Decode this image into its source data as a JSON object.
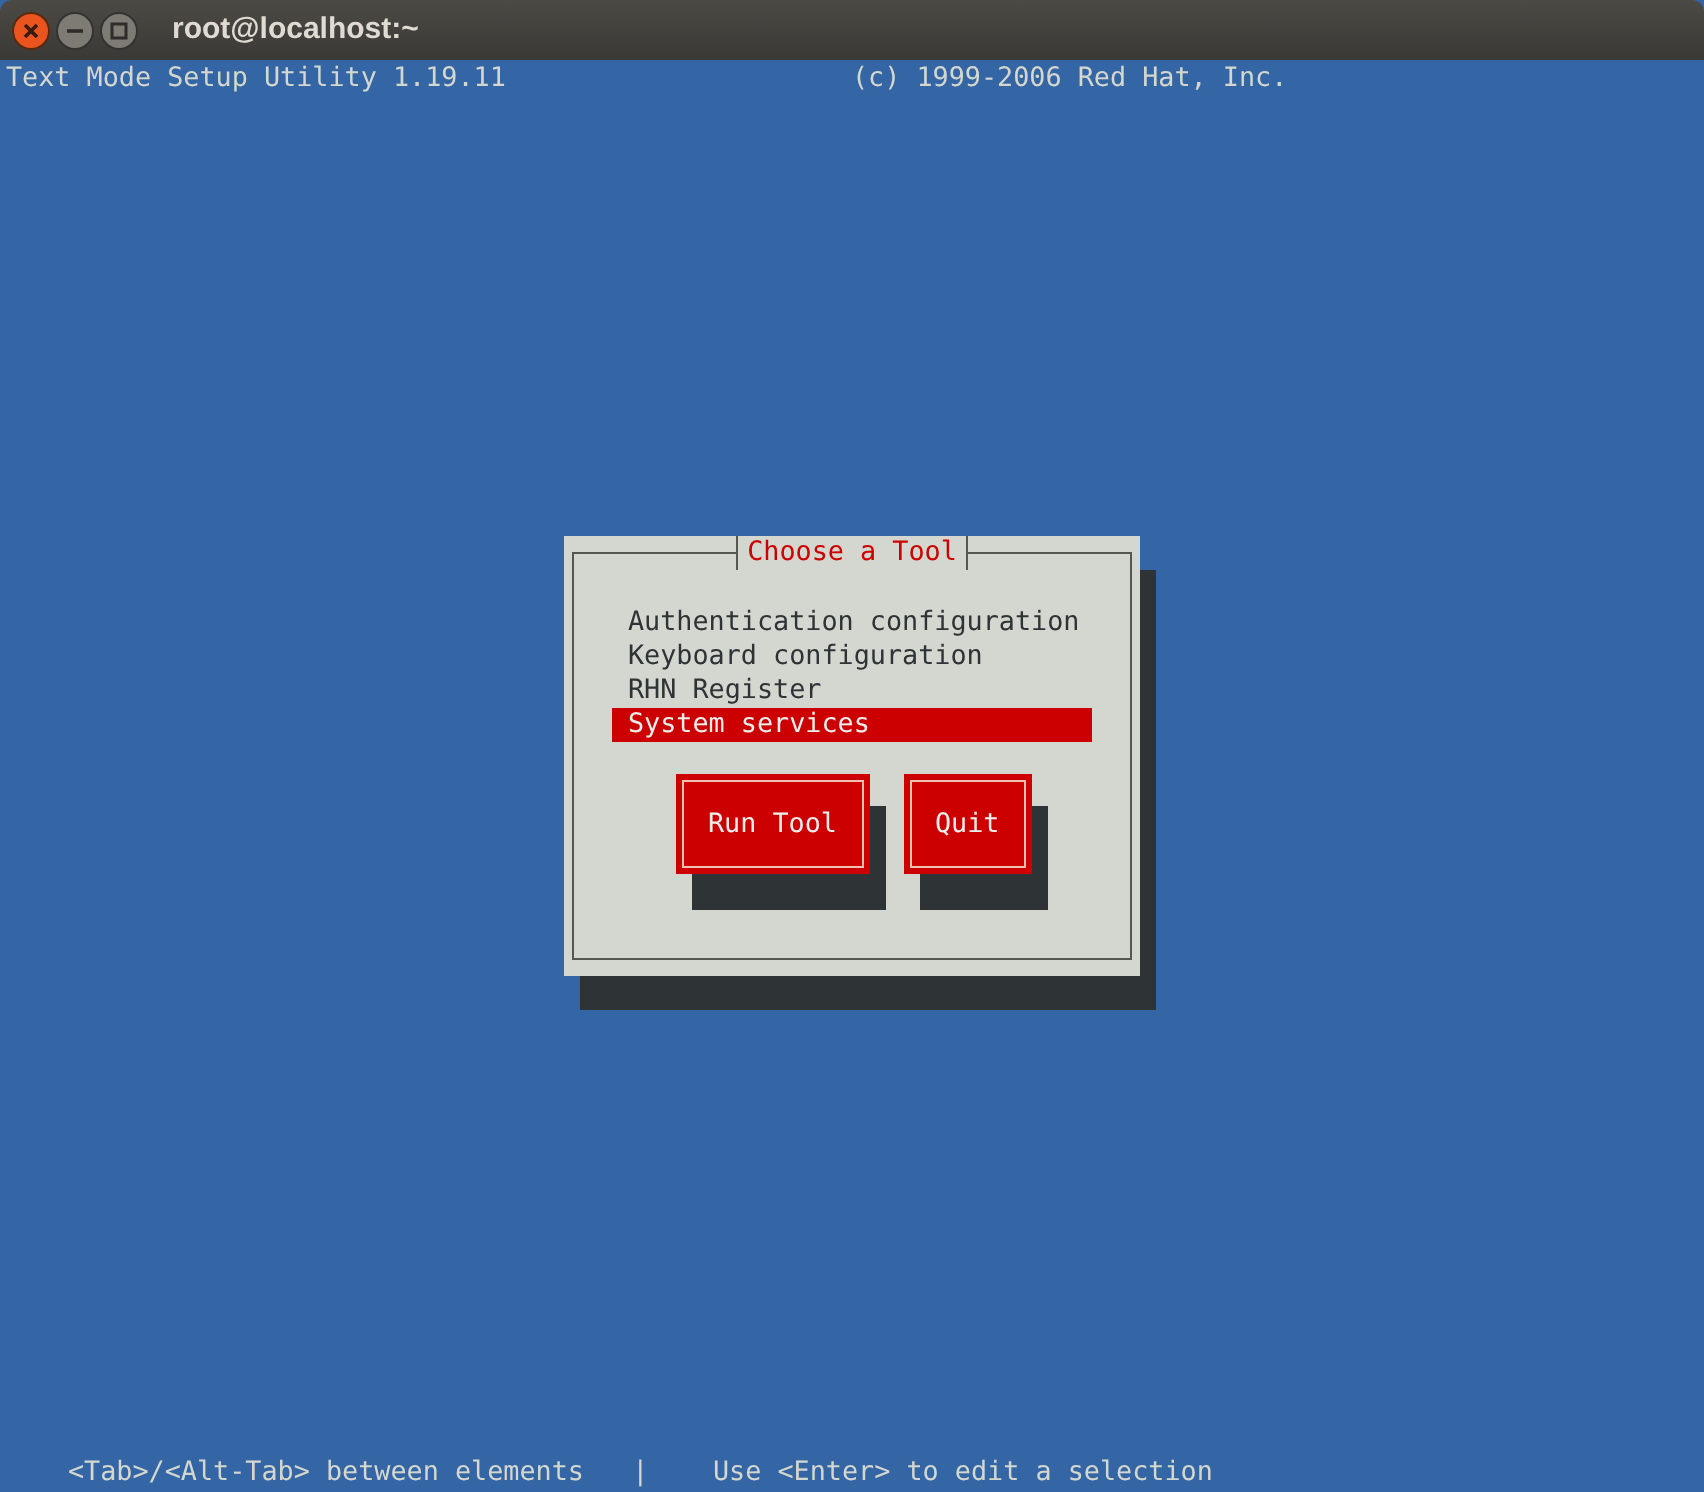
{
  "window": {
    "title": "root@localhost:~"
  },
  "header": {
    "left": "Text Mode Setup Utility 1.19.11",
    "right": "(c) 1999-2006 Red Hat, Inc."
  },
  "dialog": {
    "title": "Choose a Tool",
    "items": [
      {
        "label": "Authentication configuration",
        "selected": false
      },
      {
        "label": "Keyboard configuration",
        "selected": false
      },
      {
        "label": "RHN Register",
        "selected": false
      },
      {
        "label": "System services",
        "selected": true
      }
    ],
    "buttons": [
      "Run Tool",
      "Quit"
    ]
  },
  "status_bar": "<Tab>/<Alt-Tab> between elements   |    Use <Enter> to edit a selection"
}
